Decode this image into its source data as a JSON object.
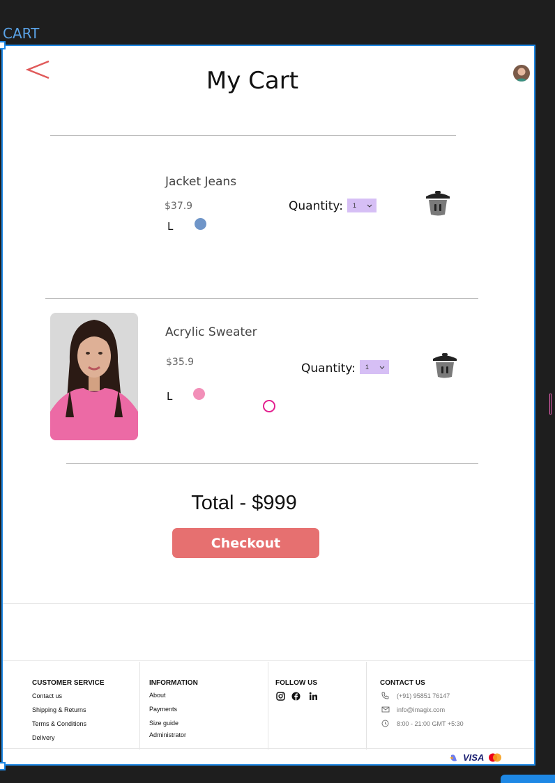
{
  "canvas": {
    "frame_label": "CART"
  },
  "header": {
    "title": "My Cart"
  },
  "cart_items": [
    {
      "name": "Jacket Jeans",
      "price": "$37.9",
      "size": "L",
      "color": "#6f95c8",
      "quantity_label": "Quantity:",
      "quantity_value": "1"
    },
    {
      "name": "Acrylic Sweater",
      "price": "$35.9",
      "size": "L",
      "color": "#f28fb8",
      "quantity_label": "Quantity:",
      "quantity_value": "1"
    }
  ],
  "summary": {
    "total": "Total - $999",
    "checkout_label": "Checkout"
  },
  "footer": {
    "customer_service": {
      "heading": "CUSTOMER SERVICE",
      "links": [
        "Contact us",
        "Shipping & Returns",
        "Terms & Conditions",
        "Delivery"
      ]
    },
    "information": {
      "heading": "INFORMATION",
      "links": [
        "About",
        "Payments",
        "Size guide",
        "Administrator"
      ]
    },
    "follow": {
      "heading": "FOLLOW US",
      "icons": [
        "instagram-icon",
        "facebook-icon",
        "linkedin-icon"
      ]
    },
    "contact": {
      "heading": "CONTACT US",
      "phone": "(+91) 95851 76147",
      "email": "info@imagix.com",
      "hours": "8:00 - 21:00 GMT +5:30"
    },
    "payment_brand": "VISA"
  },
  "colors": {
    "accent": "#e67070",
    "selection": "#1e88e5",
    "quantity_bg": "#d6bff5"
  }
}
